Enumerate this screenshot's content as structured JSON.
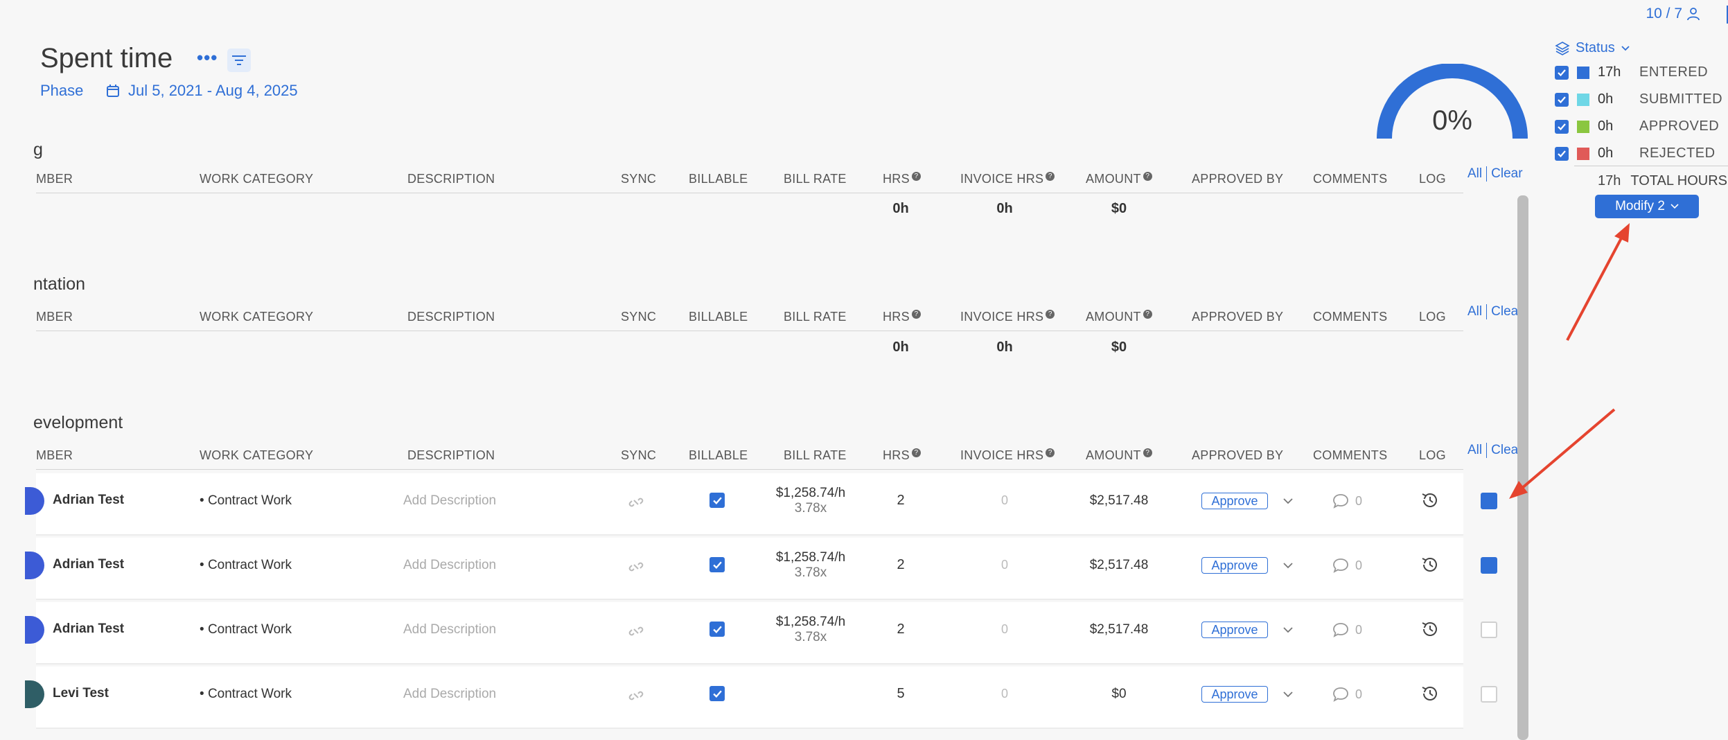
{
  "header": {
    "title": "Spent time",
    "phase_label": "Phase",
    "date_range": "Jul 5, 2021 - Aug 4, 2025",
    "users_count": "10 / 7"
  },
  "gauge": {
    "percent_label": "0%",
    "percent": 0
  },
  "status_panel": {
    "title": "Status",
    "items": [
      {
        "hours": "17h",
        "label": "ENTERED",
        "color": "#2f6fd6"
      },
      {
        "hours": "0h",
        "label": "SUBMITTED",
        "color": "#6fd7e6"
      },
      {
        "hours": "0h",
        "label": "APPROVED",
        "color": "#8ac640"
      },
      {
        "hours": "0h",
        "label": "REJECTED",
        "color": "#e05a58"
      }
    ],
    "total_hours": "17h",
    "total_label": "TOTAL HOURS",
    "modify_label": "Modify 2"
  },
  "columns": {
    "member": "MBER",
    "work_category": "WORK CATEGORY",
    "description": "DESCRIPTION",
    "sync": "SYNC",
    "billable": "BILLABLE",
    "bill_rate": "BILL RATE",
    "hrs": "HRS",
    "invoice_hrs": "INVOICE HRS",
    "amount": "AMOUNT",
    "approved_by": "APPROVED BY",
    "comments": "COMMENTS",
    "log": "LOG",
    "help_glyph": "?"
  },
  "sections": [
    {
      "title": "g",
      "member_header": "MBER",
      "all": "All",
      "clear": "Clear",
      "totals": {
        "hrs": "0h",
        "invoice_hrs": "0h",
        "amount": "$0"
      }
    },
    {
      "title": "ntation",
      "member_header": "MBER",
      "all": "All",
      "clear": "Clea",
      "totals": {
        "hrs": "0h",
        "invoice_hrs": "0h",
        "amount": "$0"
      }
    },
    {
      "title": "evelopment",
      "member_header": "MBER",
      "all": "All",
      "clear": "Clea"
    }
  ],
  "rows": [
    {
      "member": "Adrian Test",
      "work_category": "Contract Work",
      "description_placeholder": "Add Description",
      "rate": "$1,258.74/h",
      "multiplier": "3.78x",
      "hrs": "2",
      "invoice_hrs": "0",
      "amount": "$2,517.48",
      "approve_label": "Approve",
      "comments": "0",
      "selected": true,
      "avatar_color": "#3c5bd6"
    },
    {
      "member": "Adrian Test",
      "work_category": "Contract Work",
      "description_placeholder": "Add Description",
      "rate": "$1,258.74/h",
      "multiplier": "3.78x",
      "hrs": "2",
      "invoice_hrs": "0",
      "amount": "$2,517.48",
      "approve_label": "Approve",
      "comments": "0",
      "selected": true,
      "avatar_color": "#3c5bd6"
    },
    {
      "member": "Adrian Test",
      "work_category": "Contract Work",
      "description_placeholder": "Add Description",
      "rate": "$1,258.74/h",
      "multiplier": "3.78x",
      "hrs": "2",
      "invoice_hrs": "0",
      "amount": "$2,517.48",
      "approve_label": "Approve",
      "comments": "0",
      "selected": false,
      "avatar_color": "#3c5bd6"
    },
    {
      "member": "Levi Test",
      "work_category": "Contract Work",
      "description_placeholder": "Add Description",
      "rate": "",
      "multiplier": "",
      "hrs": "5",
      "invoice_hrs": "0",
      "amount": "$0",
      "approve_label": "Approve",
      "comments": "0",
      "selected": false,
      "avatar_color": "#2f5e66"
    }
  ],
  "colors": {
    "accent": "#2f6fd6",
    "annotation_arrow": "#e5442f"
  }
}
